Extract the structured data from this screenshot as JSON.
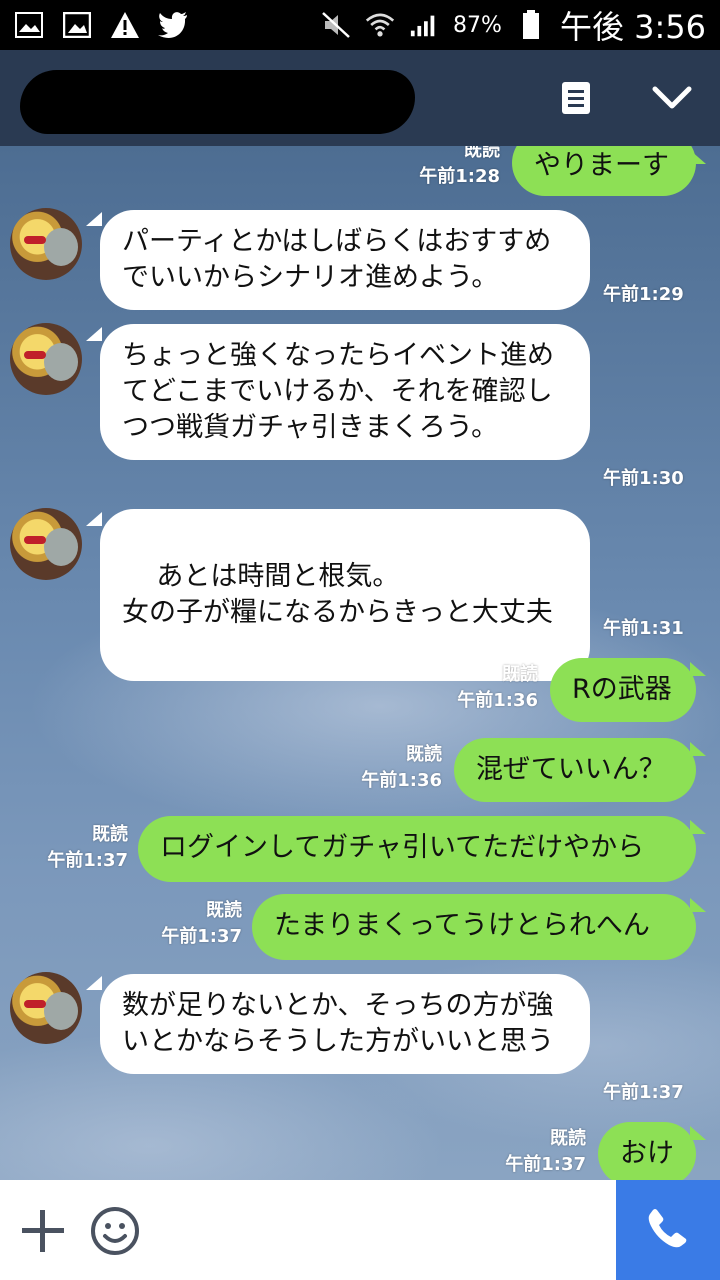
{
  "status_bar": {
    "battery": "87%",
    "time": "午後 3:56",
    "icons": [
      "gallery-icon",
      "image-icon",
      "warning-icon",
      "twitter-icon",
      "mute-icon",
      "wifi-icon",
      "signal-icon",
      "battery-icon"
    ]
  },
  "header": {
    "icons": [
      "note-icon",
      "chevron-down-icon"
    ]
  },
  "messages": [
    {
      "side": "out",
      "text": "やりまーす",
      "read": "既読",
      "time": "午前1:28"
    },
    {
      "side": "in",
      "text": "パーティとかはしばらくはおすすめでいいからシナリオ進めよう。",
      "time": "午前1:29"
    },
    {
      "side": "in",
      "text": "ちょっと強くなったらイベント進めてどこまでいけるか、それを確認しつつ戦貨ガチャ引きまくろう。",
      "time": "午前1:30"
    },
    {
      "side": "in",
      "text": "あとは時間と根気。\n女の子が糧になるからきっと大丈夫",
      "time": "午前1:31"
    },
    {
      "side": "out",
      "text": "Rの武器",
      "read": "既読",
      "time": "午前1:36"
    },
    {
      "side": "out",
      "text": "混ぜていいん？",
      "read": "既読",
      "time": "午前1:36"
    },
    {
      "side": "out",
      "text": "ログインしてガチャ引いてただけやから",
      "read": "既読",
      "time": "午前1:37"
    },
    {
      "side": "out",
      "text": "たまりまくってうけとられへん",
      "read": "既読",
      "time": "午前1:37"
    },
    {
      "side": "in",
      "text": "数が足りないとか、そっちの方が強いとかならそうした方がいいと思う",
      "time": "午前1:37"
    },
    {
      "side": "out",
      "text": "おけ",
      "read": "既読",
      "time": "午前1:37"
    }
  ],
  "colors": {
    "header_bg": "#2a3a52",
    "out_bubble": "#8de055",
    "in_bubble": "#ffffff",
    "call_button": "#3a7be6"
  },
  "input_bar": {
    "icons": [
      "plus-icon",
      "emoji-icon",
      "phone-icon"
    ]
  }
}
